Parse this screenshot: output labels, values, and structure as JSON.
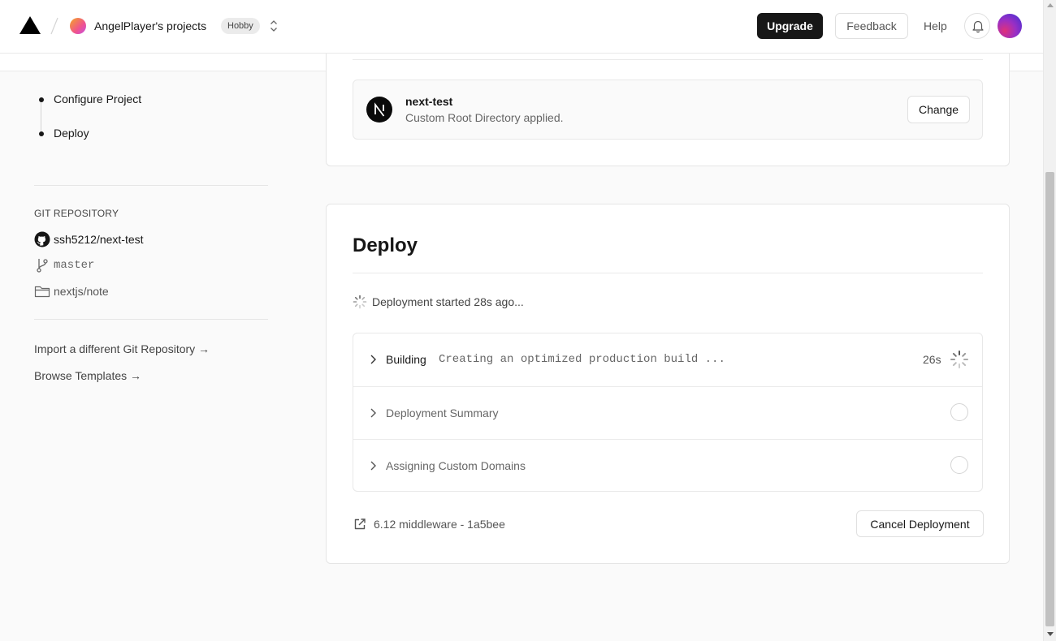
{
  "header": {
    "team_name": "AngelPlayer's projects",
    "plan_badge": "Hobby",
    "upgrade_label": "Upgrade",
    "feedback_label": "Feedback",
    "help_label": "Help",
    "icons": [
      "vercel-logo",
      "team-switcher-chevrons",
      "bell-icon",
      "user-avatar"
    ]
  },
  "sidebar": {
    "steps": [
      {
        "label": "Configure Project"
      },
      {
        "label": "Deploy"
      }
    ],
    "git_heading": "GIT REPOSITORY",
    "repo": "ssh5212/next-test",
    "branch": "master",
    "root_directory": "nextjs/note",
    "import_link": "Import a different Git Repository →",
    "templates_link": "Browse Templates →"
  },
  "project_card": {
    "name": "next-test",
    "subtitle": "Custom Root Directory applied.",
    "change_label": "Change",
    "logo_letter": "N"
  },
  "deploy": {
    "title": "Deploy",
    "status_text": "Deployment started 28s ago...",
    "steps": [
      {
        "title": "Building",
        "message": "Creating an optimized production build ...",
        "time": "26s",
        "state": "in-progress"
      },
      {
        "title": "Deployment Summary",
        "state": "pending"
      },
      {
        "title": "Assigning Custom Domains",
        "state": "pending"
      }
    ],
    "commit": "6.12 middleware - 1a5bee",
    "cancel_label": "Cancel Deployment"
  }
}
